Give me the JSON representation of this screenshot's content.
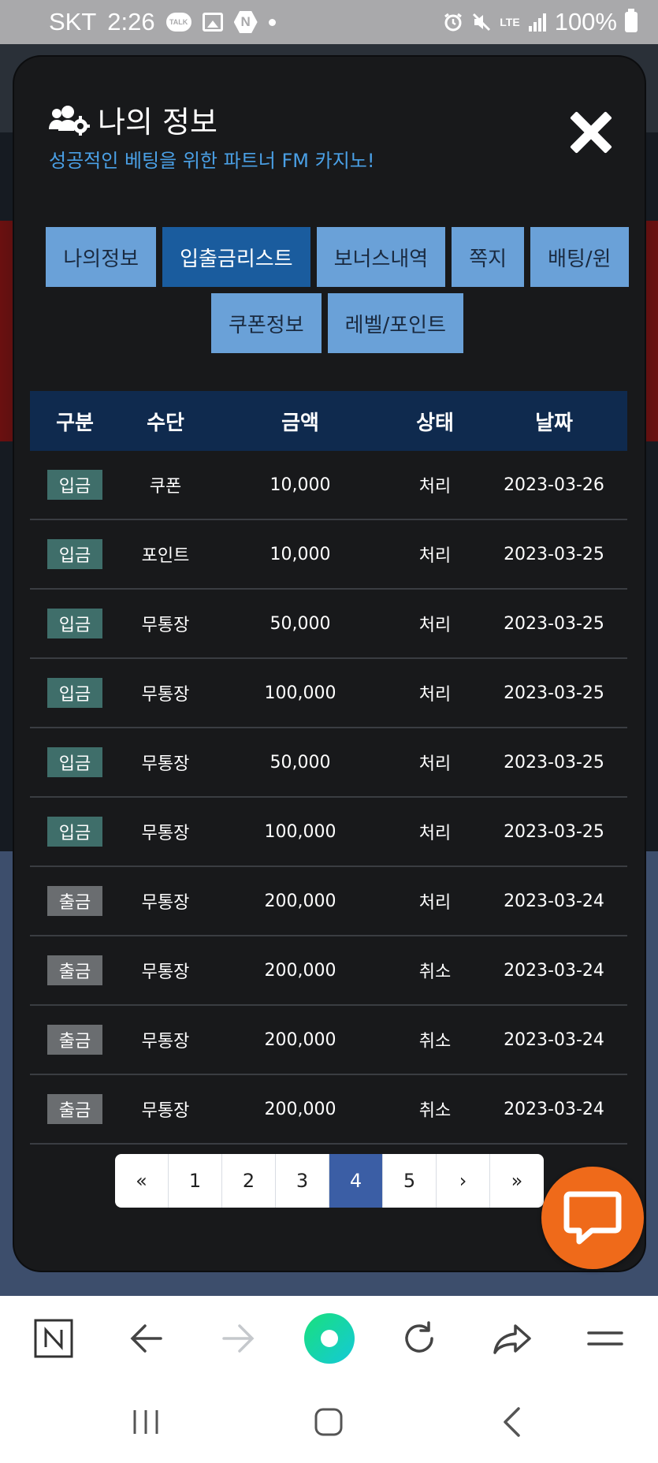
{
  "status_bar": {
    "carrier": "SKT",
    "time": "2:26",
    "talk_badge": "TALK",
    "n_badge": "N",
    "network": "LTE",
    "battery": "100%"
  },
  "modal": {
    "title": "나의 정보",
    "subtitle": "성공적인 베팅을 위한 파트너 FM 카지노!",
    "tabs": [
      {
        "label": "나의정보"
      },
      {
        "label": "입출금리스트"
      },
      {
        "label": "보너스내역"
      },
      {
        "label": "쪽지"
      },
      {
        "label": "배팅/윈"
      },
      {
        "label": "쿠폰정보"
      },
      {
        "label": "레벨/포인트"
      }
    ],
    "active_tab": "입출금리스트",
    "table": {
      "headers": [
        "구분",
        "수단",
        "금액",
        "상태",
        "날짜"
      ],
      "rows": [
        {
          "type": "입금",
          "method": "쿠폰",
          "amount": "10,000",
          "status": "처리",
          "date": "2023-03-26"
        },
        {
          "type": "입금",
          "method": "포인트",
          "amount": "10,000",
          "status": "처리",
          "date": "2023-03-25"
        },
        {
          "type": "입금",
          "method": "무통장",
          "amount": "50,000",
          "status": "처리",
          "date": "2023-03-25"
        },
        {
          "type": "입금",
          "method": "무통장",
          "amount": "100,000",
          "status": "처리",
          "date": "2023-03-25"
        },
        {
          "type": "입금",
          "method": "무통장",
          "amount": "50,000",
          "status": "처리",
          "date": "2023-03-25"
        },
        {
          "type": "입금",
          "method": "무통장",
          "amount": "100,000",
          "status": "처리",
          "date": "2023-03-25"
        },
        {
          "type": "출금",
          "method": "무통장",
          "amount": "200,000",
          "status": "처리",
          "date": "2023-03-24"
        },
        {
          "type": "출금",
          "method": "무통장",
          "amount": "200,000",
          "status": "취소",
          "date": "2023-03-24"
        },
        {
          "type": "출금",
          "method": "무통장",
          "amount": "200,000",
          "status": "취소",
          "date": "2023-03-24"
        },
        {
          "type": "출금",
          "method": "무통장",
          "amount": "200,000",
          "status": "취소",
          "date": "2023-03-24"
        }
      ]
    },
    "pagination": {
      "items": [
        "«",
        "1",
        "2",
        "3",
        "4",
        "5",
        "›",
        "»"
      ],
      "current": "4"
    }
  },
  "colors": {
    "deposit_badge": "#3f6e6a",
    "withdraw_badge": "#6a6d70",
    "active_tab": "#1a5c9e",
    "tab": "#6aa1d8",
    "table_header": "#0f2a4e",
    "chat_fab": "#ef6a1a",
    "subtitle": "#4aa0e6"
  },
  "browser_toolbar": {
    "icons": [
      "naver-home-icon",
      "back-arrow-icon",
      "forward-arrow-icon",
      "green-dot-icon",
      "refresh-icon",
      "share-icon",
      "menu-icon"
    ]
  },
  "system_nav": {
    "icons": [
      "recent-apps-icon",
      "home-icon",
      "back-icon"
    ]
  }
}
